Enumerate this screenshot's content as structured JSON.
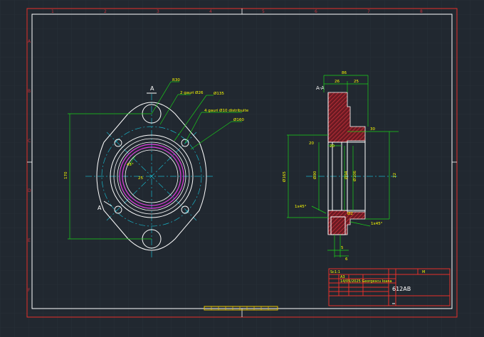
{
  "colors": {
    "background": "#212830",
    "grid": "#2b333c",
    "frame": "#e8302a",
    "border": "#ffffff",
    "dimension": "#19d219",
    "centerline": "#18b4c8",
    "text": "#ffff00",
    "part": "#ffffff",
    "hatch": "#c8323c",
    "magenta": "#e040e0"
  },
  "zone_labels": {
    "top": [
      "1",
      "2",
      "3",
      "4",
      "5",
      "6",
      "7",
      "8"
    ],
    "side": [
      "A",
      "B",
      "C",
      "D",
      "E",
      "F"
    ]
  },
  "front_view": {
    "section_label_top": "A",
    "section_label_bottom": "A",
    "notes": {
      "radius": "R30",
      "holes_two": "2 gauri Ø26",
      "diam_135": "Ø135",
      "holes_four": "4 gauri Ø10 distribuite",
      "diam_160": "Ø160"
    },
    "dims": {
      "height": "170",
      "angle": "45°",
      "small": "25"
    }
  },
  "section_view": {
    "label": "A-A",
    "dims": {
      "overall": "86",
      "top_left": "26",
      "top_right": "25",
      "mid": "30",
      "step": "20",
      "inner": "20",
      "d_left": "Ø165",
      "d_bore": "Ø90",
      "d_mid": "Ø94",
      "d_right": "Ø106",
      "right_len": "22",
      "chamfer_left": "1x45°",
      "chamfer_right": "1x45°",
      "bottom": "Ø2",
      "bot_small": "5",
      "bot_len": "6"
    }
  },
  "title_block": {
    "row1_left": "Sc1:1",
    "row1_right": "M",
    "row2": "A3",
    "row3": "14/05/2025 Georgescu Ioana",
    "part_code": "612AB"
  }
}
